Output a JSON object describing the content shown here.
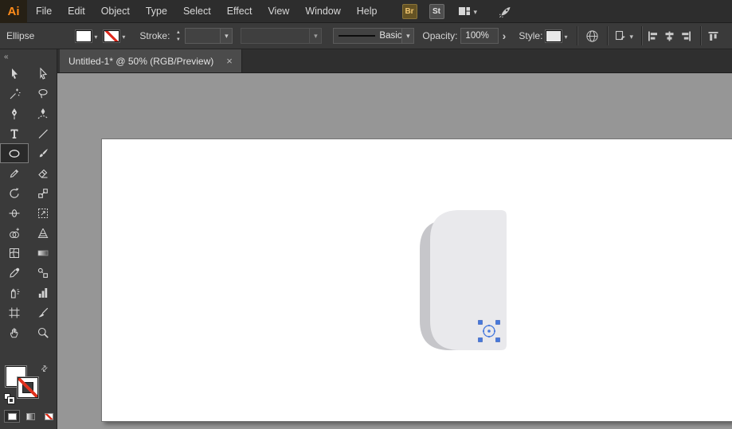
{
  "app": {
    "logo": "Ai"
  },
  "menubar": {
    "items": [
      "File",
      "Edit",
      "Object",
      "Type",
      "Select",
      "Effect",
      "View",
      "Window",
      "Help"
    ],
    "bridge_badge": "Br",
    "stock_badge": "St"
  },
  "controlbar": {
    "tool_name": "Ellipse",
    "stroke_label": "Stroke:",
    "stroke_weight_value": "",
    "brush_value": "",
    "stroke_style_value": "Basic",
    "opacity_label": "Opacity:",
    "opacity_value": "100%",
    "style_label": "Style:"
  },
  "document_tab": {
    "title": "Untitled-1* @ 50% (RGB/Preview)",
    "close_glyph": "×",
    "name": "Untitled-1",
    "zoom": "50%",
    "color_mode": "RGB/Preview"
  },
  "toolbar": {
    "collapse_glyph": "«",
    "selected_tool": "Ellipse",
    "tools": [
      "Selection",
      "Direct Selection",
      "Magic Wand",
      "Lasso",
      "Pen",
      "Curvature",
      "Type",
      "Line Segment",
      "Ellipse",
      "Paintbrush",
      "Shaper",
      "Eraser",
      "Rotate",
      "Scale",
      "Width",
      "Free Transform",
      "Shape Builder",
      "Perspective Grid",
      "Mesh",
      "Gradient",
      "Eyedropper",
      "Blend",
      "Symbol Sprayer",
      "Column Graph",
      "Artboard",
      "Slice",
      "Hand",
      "Zoom"
    ],
    "fill_color": "#ffffff",
    "stroke_color": "none"
  },
  "canvas": {
    "background_color": "#969696",
    "artboard_color": "#ffffff",
    "shape_fill": "#e9e9ec",
    "shape_shadow": "#c6c6ca",
    "selection_blue": "#4679dd"
  }
}
